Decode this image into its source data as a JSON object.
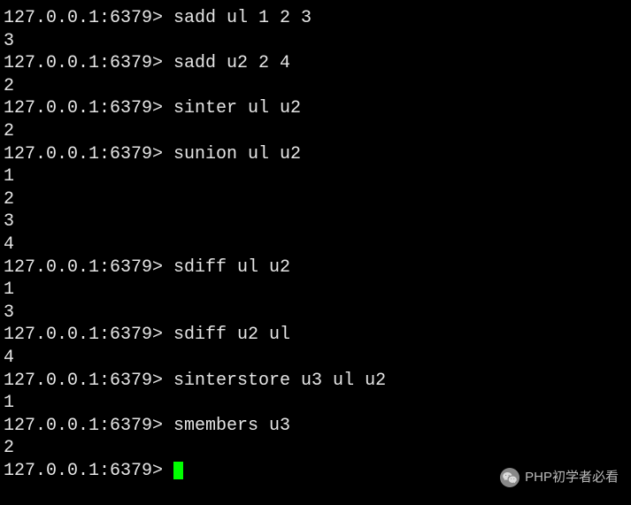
{
  "prompt": "127.0.0.1:6379> ",
  "lines": [
    {
      "type": "cmd",
      "text": "sadd ul 1 2 3"
    },
    {
      "type": "out",
      "text": "3"
    },
    {
      "type": "cmd",
      "text": "sadd u2 2 4"
    },
    {
      "type": "out",
      "text": "2"
    },
    {
      "type": "cmd",
      "text": "sinter ul u2"
    },
    {
      "type": "out",
      "text": "2"
    },
    {
      "type": "cmd",
      "text": "sunion ul u2"
    },
    {
      "type": "out",
      "text": "1"
    },
    {
      "type": "out",
      "text": "2"
    },
    {
      "type": "out",
      "text": "3"
    },
    {
      "type": "out",
      "text": "4"
    },
    {
      "type": "cmd",
      "text": "sdiff ul u2"
    },
    {
      "type": "out",
      "text": "1"
    },
    {
      "type": "out",
      "text": "3"
    },
    {
      "type": "cmd",
      "text": "sdiff u2 ul"
    },
    {
      "type": "out",
      "text": "4"
    },
    {
      "type": "cmd",
      "text": "sinterstore u3 ul u2"
    },
    {
      "type": "out",
      "text": "1"
    },
    {
      "type": "cmd",
      "text": "smembers u3"
    },
    {
      "type": "out",
      "text": "2"
    },
    {
      "type": "cursor",
      "text": ""
    }
  ],
  "watermark": {
    "text": "PHP初学者必看"
  }
}
